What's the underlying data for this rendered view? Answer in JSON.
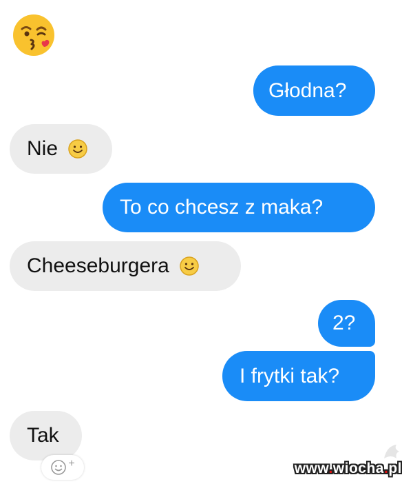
{
  "conversation": {
    "messages": [
      {
        "text": "Głodna?",
        "side": "sent",
        "emoji": ""
      },
      {
        "text": "Nie",
        "side": "received",
        "emoji": "smiley-icon"
      },
      {
        "text": "To co chcesz z maka?",
        "side": "sent",
        "emoji": ""
      },
      {
        "text": "Cheeseburgera",
        "side": "received",
        "emoji": "smiley-icon"
      },
      {
        "text": "2?",
        "side": "sent",
        "emoji": ""
      },
      {
        "text": "I frytki tak?",
        "side": "sent",
        "emoji": ""
      },
      {
        "text": "Tak",
        "side": "received",
        "emoji": ""
      }
    ],
    "top_emoji": "kissing-face-icon"
  },
  "reaction_button": {
    "icon": "add-reaction-icon",
    "plus": "+"
  },
  "watermark": {
    "text_a": "www",
    "dot1": ".",
    "text_b": "wiocha",
    "dot2": ".",
    "text_c": "pl"
  },
  "colors": {
    "sent_bubble": "#1a8cf7",
    "received_bubble": "#ececec",
    "sent_text": "#ffffff",
    "received_text": "#111111"
  }
}
